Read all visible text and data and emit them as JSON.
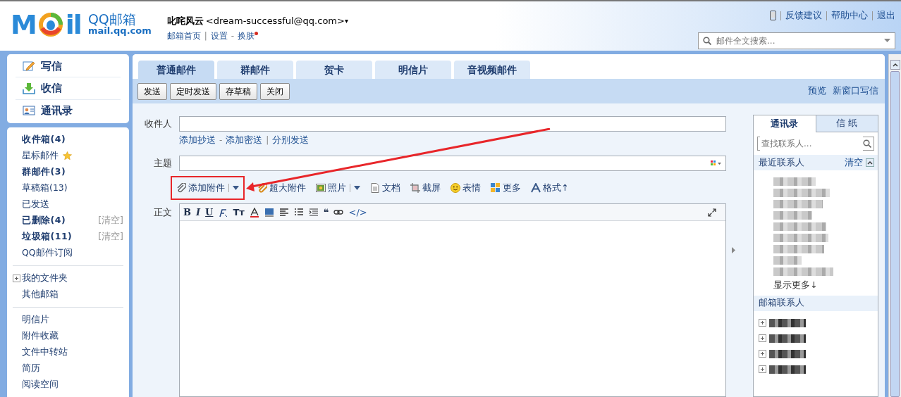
{
  "header": {
    "logo": {
      "letter_left": "M",
      "letter_right": "il",
      "title": "QQ邮箱",
      "domain": "mail.qq.com"
    },
    "user": {
      "name": "叱咤风云",
      "email": "<dream-successful@qq.com>",
      "caret": "▾"
    },
    "user_links": [
      {
        "label": "邮箱首页",
        "notify": false
      },
      {
        "label": "设置",
        "sep": "|",
        "notify": false
      },
      {
        "label": "换肤",
        "sep": "-",
        "notify": true
      }
    ],
    "top_links": [
      {
        "kind": "phone"
      },
      {
        "kind": "link",
        "label": "反馈建议"
      },
      {
        "kind": "link",
        "label": "帮助中心"
      },
      {
        "kind": "link",
        "label": "退出"
      }
    ],
    "search": {
      "placeholder": "邮件全文搜索..."
    }
  },
  "sidebar": {
    "quick_actions": [
      {
        "kind": "compose",
        "label": "写信"
      },
      {
        "kind": "inbox",
        "label": "收信"
      },
      {
        "kind": "contacts",
        "label": "通讯录"
      }
    ],
    "groups": [
      [
        {
          "label": "收件箱(4)",
          "bold": true,
          "star": false
        },
        {
          "label": "星标邮件",
          "bold": false,
          "star": true
        },
        {
          "label": "群邮件(3)",
          "bold": true,
          "star": false
        },
        {
          "label": "草稿箱(13)",
          "bold": false,
          "star": false
        },
        {
          "label": "已发送",
          "bold": false,
          "star": false
        },
        {
          "label": "已删除(4)",
          "bold": true,
          "star": false,
          "action": "[清空]"
        },
        {
          "label": "垃圾箱(11)",
          "bold": true,
          "star": false,
          "action": "[清空]"
        },
        {
          "label": "QQ邮件订阅",
          "bold": false,
          "star": false
        }
      ],
      [
        {
          "label": "我的文件夹",
          "bold": false,
          "star": false,
          "expandable": true
        },
        {
          "label": "其他邮箱",
          "bold": false,
          "star": false,
          "expandable": false
        }
      ],
      [
        {
          "label": "明信片",
          "bold": false,
          "star": false
        },
        {
          "label": "附件收藏",
          "bold": false,
          "star": false
        },
        {
          "label": "文件中转站",
          "bold": false,
          "star": false
        },
        {
          "label": "简历",
          "bold": false,
          "star": false
        },
        {
          "label": "阅读空间",
          "bold": false,
          "star": false
        }
      ]
    ]
  },
  "tabs": [
    {
      "label": "普通邮件",
      "selected": true
    },
    {
      "label": "群邮件",
      "selected": false
    },
    {
      "label": "贺卡",
      "selected": false
    },
    {
      "label": "明信片",
      "selected": false
    },
    {
      "label": "音视频邮件",
      "selected": false
    }
  ],
  "toolbar": {
    "buttons": [
      "发送",
      "定时发送",
      "存草稿",
      "关闭"
    ],
    "links": [
      "预览",
      "新窗口写信"
    ]
  },
  "compose": {
    "recipient_label": "收件人",
    "recipient_links": [
      {
        "label": "添加抄送"
      },
      {
        "label": "添加密送",
        "sep": "-"
      },
      {
        "label": "分别发送",
        "sep": "|"
      }
    ],
    "subject_label": "主题",
    "attach_tools": [
      {
        "kind": "clip",
        "label": "添加附件",
        "dropdown": true,
        "highlighted": true
      },
      {
        "kind": "bigclip",
        "label": "超大附件",
        "dropdown": false,
        "highlighted": false
      },
      {
        "kind": "photo",
        "label": "照片",
        "dropdown": true,
        "highlighted": false
      },
      {
        "kind": "doc",
        "label": "文档",
        "dropdown": false,
        "highlighted": false
      },
      {
        "kind": "screenshot",
        "label": "截屏",
        "dropdown": false,
        "highlighted": false
      },
      {
        "kind": "emoji",
        "label": "表情",
        "dropdown": false,
        "highlighted": false
      },
      {
        "kind": "more",
        "label": "更多",
        "dropdown": false,
        "highlighted": false
      },
      {
        "kind": "format",
        "label": "格式↑",
        "dropdown": false,
        "highlighted": false
      }
    ],
    "body_label": "正文",
    "editor_tools": [
      {
        "kind": "bold",
        "glyph": "B"
      },
      {
        "kind": "italic",
        "glyph": "I"
      },
      {
        "kind": "underline",
        "glyph": "U"
      },
      {
        "kind": "font"
      },
      {
        "kind": "size",
        "glyph": "Tт"
      },
      {
        "kind": "color"
      },
      {
        "kind": "bgcolor"
      },
      {
        "kind": "align"
      },
      {
        "kind": "list"
      },
      {
        "kind": "indent"
      },
      {
        "kind": "quote",
        "glyph": "❝"
      },
      {
        "kind": "link"
      },
      {
        "kind": "code",
        "glyph": "</>"
      }
    ]
  },
  "annotation": {
    "kind": "arrow"
  },
  "contacts": {
    "tabs": [
      {
        "label": "通讯录",
        "selected": true
      },
      {
        "label": "信 纸",
        "selected": false
      }
    ],
    "search_placeholder": "查找联系人...",
    "recent": {
      "title": "最近联系人",
      "action": "清空",
      "entries": [
        {
          "kind": "blurred"
        },
        {
          "kind": "blurred"
        },
        {
          "kind": "blurred"
        },
        {
          "kind": "blurred"
        },
        {
          "kind": "blurred"
        },
        {
          "kind": "blurred"
        },
        {
          "kind": "blurred"
        },
        {
          "kind": "blurred"
        },
        {
          "kind": "blurred"
        }
      ],
      "more": "显示更多↓"
    },
    "mailbox": {
      "title": "邮箱联系人",
      "groups": [
        {
          "kind": "blurred",
          "expandable": true
        },
        {
          "kind": "blurred",
          "expandable": true
        },
        {
          "kind": "blurred",
          "expandable": true
        },
        {
          "kind": "blurred",
          "expandable": true
        }
      ]
    }
  }
}
